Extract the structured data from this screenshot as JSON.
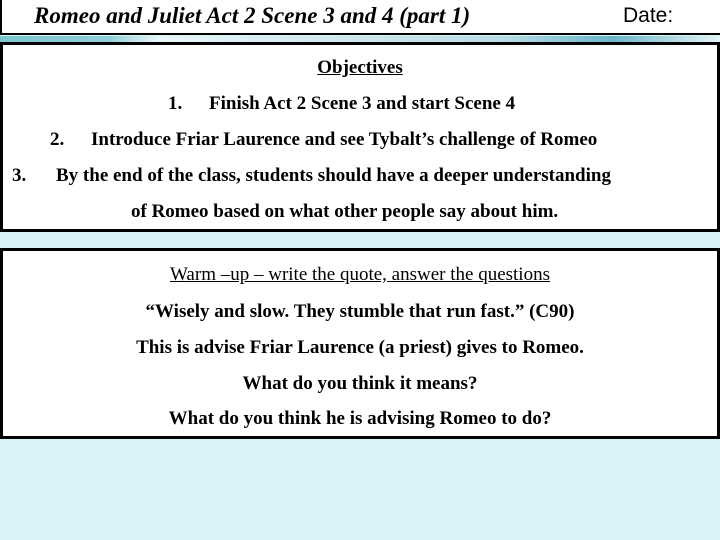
{
  "header": {
    "title": "Romeo and Juliet Act 2 Scene 3 and 4 (part 1)",
    "date_label": "Date:"
  },
  "objectives": {
    "heading": "Objectives",
    "items": [
      {
        "number": "1.",
        "text": "Finish Act 2 Scene 3 and start Scene 4"
      },
      {
        "number": "2.",
        "text": "Introduce Friar Laurence and see Tybalt’s challenge of Romeo"
      },
      {
        "number": "3.",
        "text": "By the end of the class, students should have a deeper understanding",
        "continuation": "of Romeo based on what other people say about him."
      }
    ]
  },
  "warmup": {
    "heading": "Warm –up – write the quote, answer the questions",
    "lines": [
      "“Wisely and slow. They stumble that run fast.” (C90)",
      "This is advise Friar Laurence (a priest) gives to Romeo.",
      "What do you think it means?",
      "What do you think he is advising Romeo to do?"
    ]
  },
  "colors": {
    "background": "#daf3f8",
    "accent_strip": "#7ec4cf",
    "border": "#000000"
  }
}
